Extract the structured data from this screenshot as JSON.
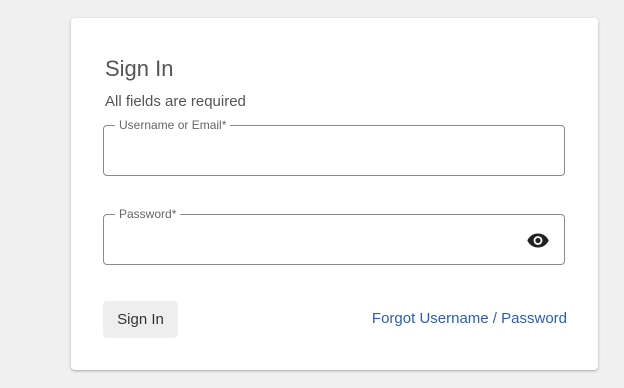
{
  "form": {
    "title": "Sign In",
    "subtitle": "All fields are required",
    "username": {
      "label": "Username or Email*",
      "value": "",
      "placeholder": ""
    },
    "password": {
      "label": "Password*",
      "value": "",
      "placeholder": "",
      "toggle_icon": "eye-icon"
    },
    "submit_label": "Sign In",
    "forgot_label": "Forgot Username / Password"
  },
  "colors": {
    "background": "#f0f0f0",
    "card": "#ffffff",
    "link": "#2e5fa7",
    "button": "#eeeeee",
    "border": "#8a8a8a"
  }
}
